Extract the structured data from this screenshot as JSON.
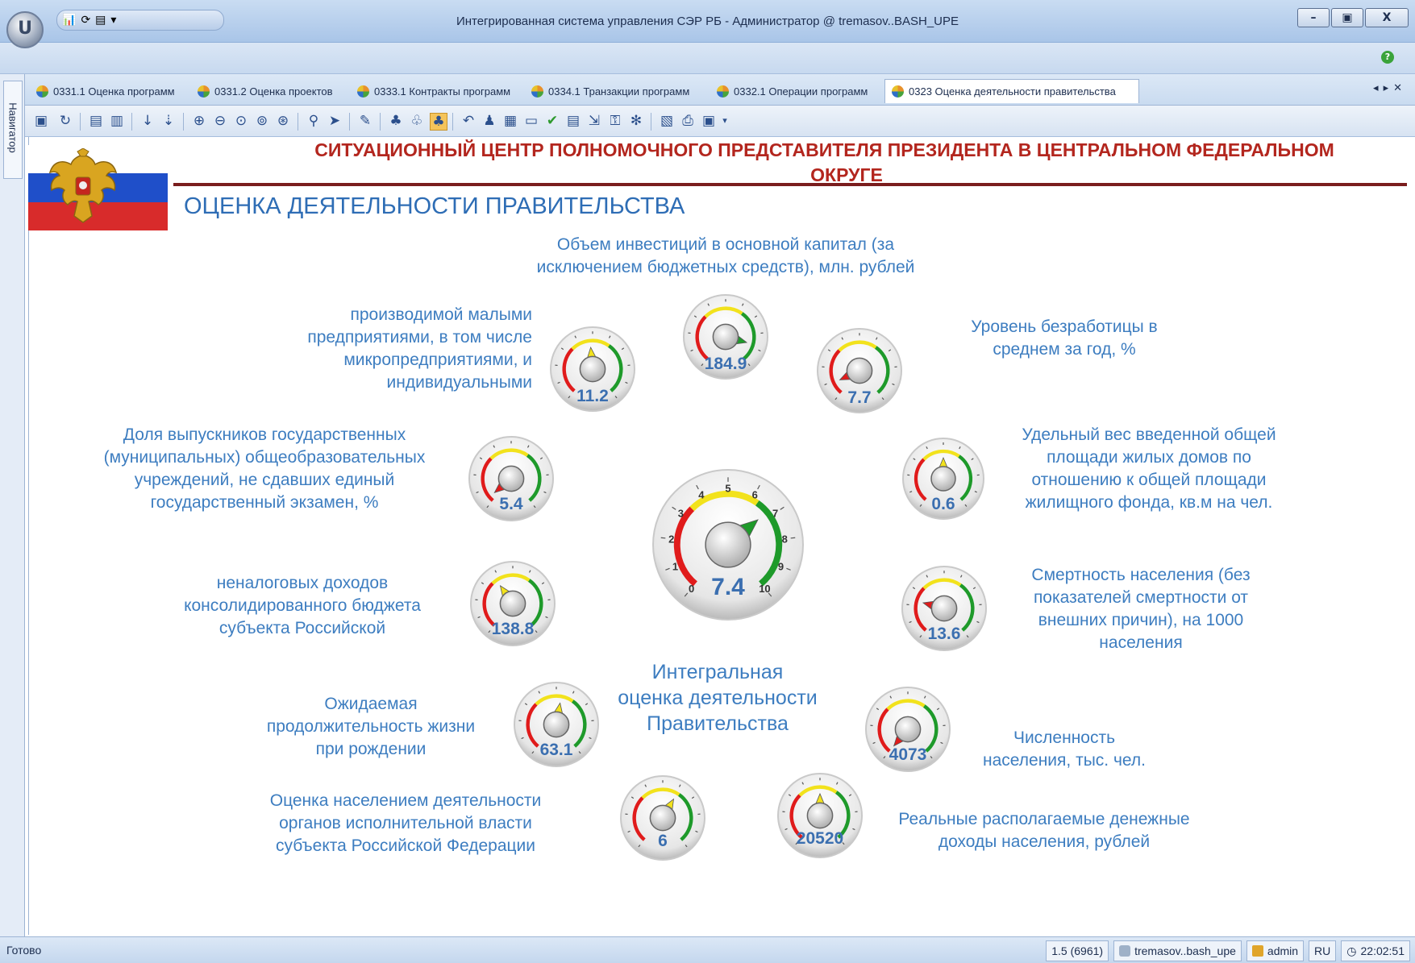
{
  "window": {
    "title": "Интегрированная система управления СЭР РБ - Администратор @ tremasov..BASH_UPE",
    "orb_letter": "U"
  },
  "navigator": {
    "label": "Навигатор"
  },
  "tabs": [
    {
      "label": "0331.1 Оценка программ"
    },
    {
      "label": "0331.2 Оценка проектов"
    },
    {
      "label": "0333.1 Контракты программ"
    },
    {
      "label": "0334.1 Транзакции программ"
    },
    {
      "label": "0332.1 Операции программ"
    },
    {
      "label": "0323 Оценка деятельности правительства"
    }
  ],
  "header": {
    "line1": "СИТУАЦИОННЫЙ ЦЕНТР ПОЛНОМОЧНОГО ПРЕДСТАВИТЕЛЯ ПРЕЗИДЕНТА В ЦЕНТРАЛЬНОМ ФЕДЕРАЛЬНОМ",
    "line2": "ОКРУГЕ",
    "page_title": "ОЦЕНКА ДЕЯТЕЛЬНОСТИ ПРАВИТЕЛЬСТВА"
  },
  "colors": {
    "header_red": "#b3261e",
    "label_blue": "#3d7dc0",
    "value_blue": "#3b6fb0",
    "gauge_red": "#e01b1b",
    "gauge_yellow": "#f2e21c",
    "gauge_green": "#1e9a2a"
  },
  "labels": {
    "investments": "Объем инвестиций в основной капитал (за исключением бюджетных средств), млн. рублей",
    "small_business": "производимой малыми предприятиями, в том числе микропредприятиями, и индивидуальными",
    "unemployment": "Уровень безработицы в среднем за год, %",
    "graduates": "Доля выпускников государственных (муниципальных) общеобразовательных учреждений, не сдавших единый государственный экзамен, %",
    "housing": "Удельный вес введенной общей площади жилых домов по отношению к общей площади жилищного фонда, кв.м на чел.",
    "nontax": "неналоговых доходов консолидированного бюджета субъекта Российской",
    "mortality": "Смертность населения (без показателей смертности от внешних причин), на 1000 населения",
    "integral": "Интегральная оценка деятельности Правительства",
    "life": "Ожидаемая продолжительность жизни при рождении",
    "population": "Численность населения, тыс. чел.",
    "assessment": "Оценка населением деятельности органов исполнительной власти субъекта Российской Федерации",
    "income": "Реальные располагаемые денежные доходы населения, рублей"
  },
  "gauges": {
    "investments": {
      "value": "184.9"
    },
    "small_business": {
      "value": "11.2"
    },
    "unemployment": {
      "value": "7.7"
    },
    "graduates": {
      "value": "5.4"
    },
    "housing": {
      "value": "0.6"
    },
    "nontax": {
      "value": "138.8"
    },
    "mortality": {
      "value": "13.6"
    },
    "integral": {
      "value": "7.4",
      "ticks": [
        "0",
        "1",
        "2",
        "3",
        "4",
        "5",
        "6",
        "7",
        "8",
        "9",
        "10"
      ]
    },
    "life": {
      "value": "63.1"
    },
    "population": {
      "value": "4073"
    },
    "assessment": {
      "value": "6"
    },
    "income": {
      "value": "20520"
    }
  },
  "status": {
    "left": "Готово",
    "version": "1.5 (6961)",
    "db": "tremasov..bash_upe",
    "user": "admin",
    "lang": "RU",
    "time": "22:02:51"
  }
}
